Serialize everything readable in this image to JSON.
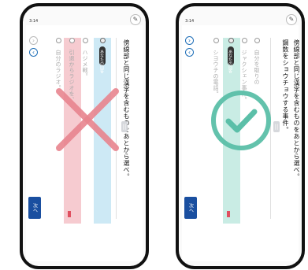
{
  "phones": [
    {
      "result": "incorrect",
      "status_time": "3:14",
      "options": [
        "自分のラジオ。",
        "引退からラジオを、",
        "ハジメ戦。"
      ],
      "selected_badge": "あなたの回答",
      "prompt_line": "傍線部と同じ漢字を含むものをあとから選べ。",
      "next_label": "次へ",
      "handle_glyph": "||",
      "colors": {
        "band_left": "#f6cbd0",
        "band_right": "#cde9f5",
        "mark": "#e8858f"
      }
    },
    {
      "result": "correct",
      "status_time": "3:14",
      "options": [
        "シヨウチの電話。",
        "ジャクシェン事件。",
        "自分を取りの"
      ],
      "selected_badge": "あなたの回答",
      "prompt_line_1": "傍線部と同じ漢字を含むものをあとから選べ。",
      "prompt_line_2": "鋼数をショウチョウする事件。",
      "next_label": "次へ",
      "handle_glyph": "||",
      "colors": {
        "band": "#c9ece4",
        "mark": "#5bbfa8"
      }
    }
  ],
  "icons": {
    "pencil": "pencil-icon",
    "prev": "chevron-left-icon",
    "next": "chevron-right-icon",
    "wrong": "cross-mark-icon",
    "right": "check-circle-icon"
  }
}
